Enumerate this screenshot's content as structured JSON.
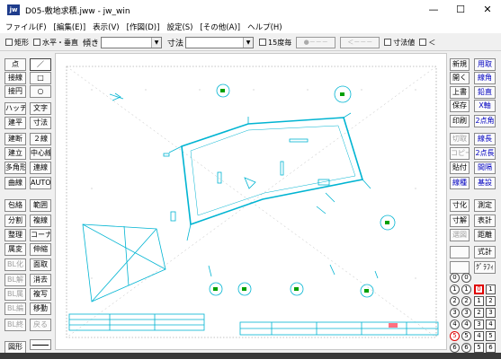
{
  "window": {
    "title": "D05-敷地求積.jww - jw_win",
    "app_icon": "jw",
    "minimize": "—",
    "maximize": "☐",
    "close": "✕"
  },
  "menu": [
    "ファイル(F)",
    "[編集(E)]",
    "表示(V)",
    "[作図(D)]",
    "設定(S)",
    "[その他(A)]",
    "ヘルプ(H)"
  ],
  "toolbar": {
    "rect_label": "矩形",
    "hv_label": "水平・垂直",
    "slope_label": "傾き",
    "dim_label": "寸法",
    "deg15_label": "15度毎",
    "btn1": "●－－－",
    "btn2": "＜－－－",
    "dimval_label": "寸法値",
    "lt_label": "＜"
  },
  "left_tools": [
    [
      "点",
      "／"
    ],
    [
      "接線",
      "□"
    ],
    [
      "接円",
      "○"
    ],
    [
      "ハッチ",
      "文字"
    ],
    [
      "建平",
      "寸法"
    ],
    [
      "建断",
      "２線"
    ],
    [
      "建立",
      "中心線"
    ],
    [
      "多角形",
      "連線"
    ],
    [
      "曲線",
      "AUTO"
    ],
    [
      "包絡",
      "範囲"
    ],
    [
      "分割",
      "複線"
    ],
    [
      "整理",
      "コーナー"
    ],
    [
      "属変",
      "伸縮"
    ],
    [
      "BL化",
      "面取"
    ],
    [
      "BL解",
      "消去"
    ],
    [
      "BL属",
      "複写"
    ],
    [
      "BL編",
      "移動"
    ],
    [
      "BL終",
      "戻る"
    ]
  ],
  "right_tools": [
    [
      "新規",
      "用取"
    ],
    [
      "開く",
      "線角"
    ],
    [
      "上書",
      "鉛直"
    ],
    [
      "保存",
      "X軸"
    ],
    [
      "印刷",
      "2点角"
    ],
    [
      "切取",
      "線長"
    ],
    [
      "コピー",
      "2点長"
    ],
    [
      "貼付",
      "間隔"
    ],
    [
      "線種",
      "基設"
    ],
    [
      "寸化",
      "測定"
    ],
    [
      "寸解",
      "表計"
    ],
    [
      "選図",
      "距離"
    ],
    [
      "",
      "式計"
    ],
    [
      "",
      "ｸﾞﾗﾌｨ"
    ]
  ],
  "bottom_left": {
    "zukei": "図形"
  },
  "layers": {
    "circles": [
      "0",
      "1",
      "2",
      "3",
      "4",
      "5",
      "6"
    ],
    "squares": [
      "0",
      "1",
      "2",
      "3",
      "4",
      "5",
      "6"
    ],
    "active_group": "5",
    "active_layer": "0"
  },
  "colors": {
    "drawing": "#00b4d2",
    "accent_green": "#00a000",
    "selection": "#e00000"
  }
}
